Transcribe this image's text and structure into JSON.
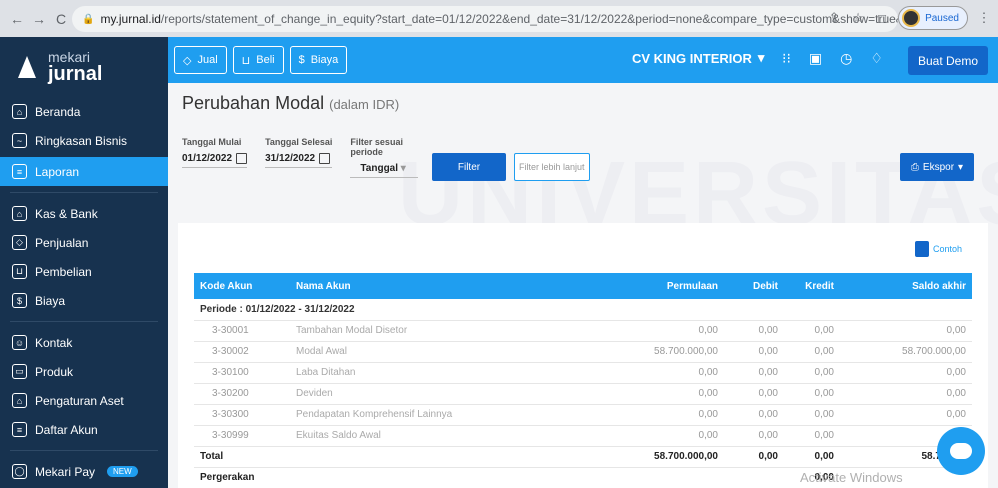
{
  "browser": {
    "url_host": "my.jurnal.id",
    "url_rest": "/reports/statement_of_change_in_equity?start_date=01/12/2022&end_date=31/12/2022&period=none&compare_type=custom&show=true&...",
    "paused_label": "Paused"
  },
  "sidebar": {
    "logo_top": "mekari",
    "logo_bottom": "jurnal",
    "items": [
      {
        "label": "Beranda"
      },
      {
        "label": "Ringkasan Bisnis"
      },
      {
        "label": "Laporan"
      },
      {
        "label": "Kas & Bank"
      },
      {
        "label": "Penjualan"
      },
      {
        "label": "Pembelian"
      },
      {
        "label": "Biaya"
      },
      {
        "label": "Kontak"
      },
      {
        "label": "Produk"
      },
      {
        "label": "Pengaturan Aset"
      },
      {
        "label": "Daftar Akun"
      },
      {
        "label": "Mekari Pay"
      }
    ],
    "new_badge": "NEW"
  },
  "appbar": {
    "jual": "Jual",
    "beli": "Beli",
    "biaya": "Biaya",
    "company": "CV KING INTERIOR",
    "demo": "Buat Demo"
  },
  "page": {
    "title": "Perubahan Modal",
    "unit": "(dalam IDR)",
    "start_label": "Tanggal Mulai",
    "start_value": "01/12/2022",
    "end_label": "Tanggal Selesai",
    "end_value": "31/12/2022",
    "filter_label": "Filter sesuai periode",
    "filter_value": "Tanggal",
    "filter_button": "Filter",
    "filter_more_placeholder": "Filter lebih lanjut",
    "export_button": "Ekspor",
    "example": "Contoh"
  },
  "table": {
    "headers": [
      "Kode Akun",
      "Nama Akun",
      "Permulaan",
      "Debit",
      "Kredit",
      "Saldo akhir"
    ],
    "period": "Periode : 01/12/2022 - 31/12/2022",
    "rows": [
      {
        "code": "3-30001",
        "name": "Tambahan Modal Disetor",
        "start": "0,00",
        "debit": "0,00",
        "credit": "0,00",
        "end": "0,00"
      },
      {
        "code": "3-30002",
        "name": "Modal Awal",
        "start": "58.700.000,00",
        "debit": "0,00",
        "credit": "0,00",
        "end": "58.700.000,00"
      },
      {
        "code": "3-30100",
        "name": "Laba Ditahan",
        "start": "0,00",
        "debit": "0,00",
        "credit": "0,00",
        "end": "0,00"
      },
      {
        "code": "3-30200",
        "name": "Deviden",
        "start": "0,00",
        "debit": "0,00",
        "credit": "0,00",
        "end": "0,00"
      },
      {
        "code": "3-30300",
        "name": "Pendapatan Komprehensif Lainnya",
        "start": "0,00",
        "debit": "0,00",
        "credit": "0,00",
        "end": "0,00"
      },
      {
        "code": "3-30999",
        "name": "Ekuitas Saldo Awal",
        "start": "0,00",
        "debit": "0,00",
        "credit": "0,00",
        "end": "0,0"
      }
    ],
    "total": {
      "label": "Total",
      "start": "58.700.000,00",
      "debit": "0,00",
      "credit": "0,00",
      "end": "58.700.00"
    },
    "movement": {
      "label": "Pergerakan",
      "value": "0,00"
    }
  },
  "overlay": {
    "activate": "Activate Windows",
    "watermark": "UNIVERSITAS"
  }
}
